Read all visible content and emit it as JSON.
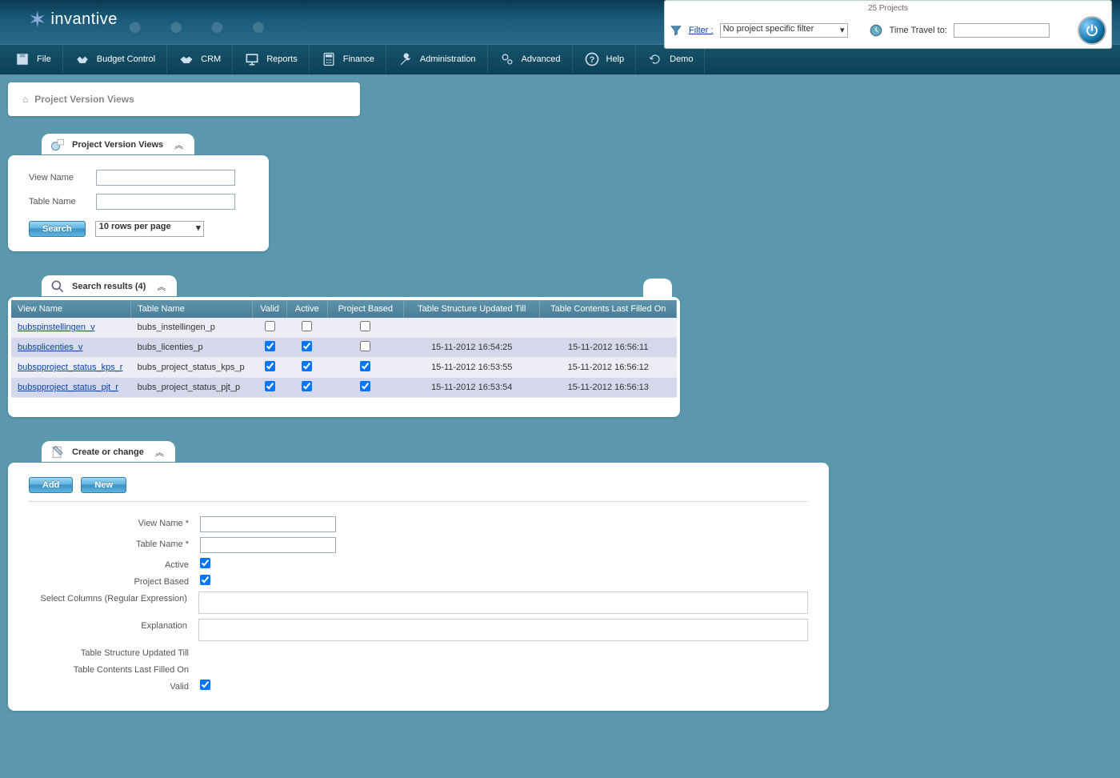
{
  "brand": "invantive",
  "header": {
    "projects_count": "25 Projects",
    "filter_label": "Filter :",
    "filter_value": "No project specific filter",
    "time_travel_label": "Time Travel to:"
  },
  "nav": [
    {
      "label": "File",
      "icon": "disk"
    },
    {
      "label": "Budget Control",
      "icon": "handshake"
    },
    {
      "label": "CRM",
      "icon": "handshake2"
    },
    {
      "label": "Reports",
      "icon": "board"
    },
    {
      "label": "Finance",
      "icon": "calc"
    },
    {
      "label": "Administration",
      "icon": "wrench"
    },
    {
      "label": "Advanced",
      "icon": "gears"
    },
    {
      "label": "Help",
      "icon": "help"
    },
    {
      "label": "Demo",
      "icon": "refresh"
    }
  ],
  "breadcrumb": "Project Version Views",
  "search_panel": {
    "title": "Project Version Views",
    "view_name_label": "View Name",
    "table_name_label": "Table Name",
    "search_btn": "Search",
    "rows_option": "10 rows per page"
  },
  "results": {
    "title": "Search results (4)",
    "cols": [
      "View Name",
      "Table Name",
      "Valid",
      "Active",
      "Project Based",
      "Table Structure Updated Till",
      "Table Contents Last Filled On"
    ],
    "rows": [
      {
        "view": "bubspinstellingen_v",
        "table": "bubs_instellingen_p",
        "valid": false,
        "active": false,
        "pb": false,
        "till": "",
        "filled": ""
      },
      {
        "view": "bubsplicenties_v",
        "table": "bubs_licenties_p",
        "valid": true,
        "active": true,
        "pb": false,
        "till": "15-11-2012 16:54:25",
        "filled": "15-11-2012 16:56:11"
      },
      {
        "view": "bubspproject_status_kps_r",
        "table": "bubs_project_status_kps_p",
        "valid": true,
        "active": true,
        "pb": true,
        "till": "15-11-2012 16:53:55",
        "filled": "15-11-2012 16:56:12"
      },
      {
        "view": "bubspproject_status_pjt_r",
        "table": "bubs_project_status_pjt_p",
        "valid": true,
        "active": true,
        "pb": true,
        "till": "15-11-2012 16:53:54",
        "filled": "15-11-2012 16:56:13"
      }
    ]
  },
  "edit": {
    "title": "Create or change",
    "add_btn": "Add",
    "new_btn": "New",
    "labels": {
      "view_name": "View Name *",
      "table_name": "Table Name *",
      "active": "Active",
      "project_based": "Project Based",
      "select_columns": "Select Columns (Regular Expression)",
      "explanation": "Explanation",
      "updated_till": "Table Structure Updated Till",
      "last_filled": "Table Contents Last Filled On",
      "valid": "Valid"
    },
    "values": {
      "active": true,
      "project_based": true,
      "valid": true
    }
  }
}
